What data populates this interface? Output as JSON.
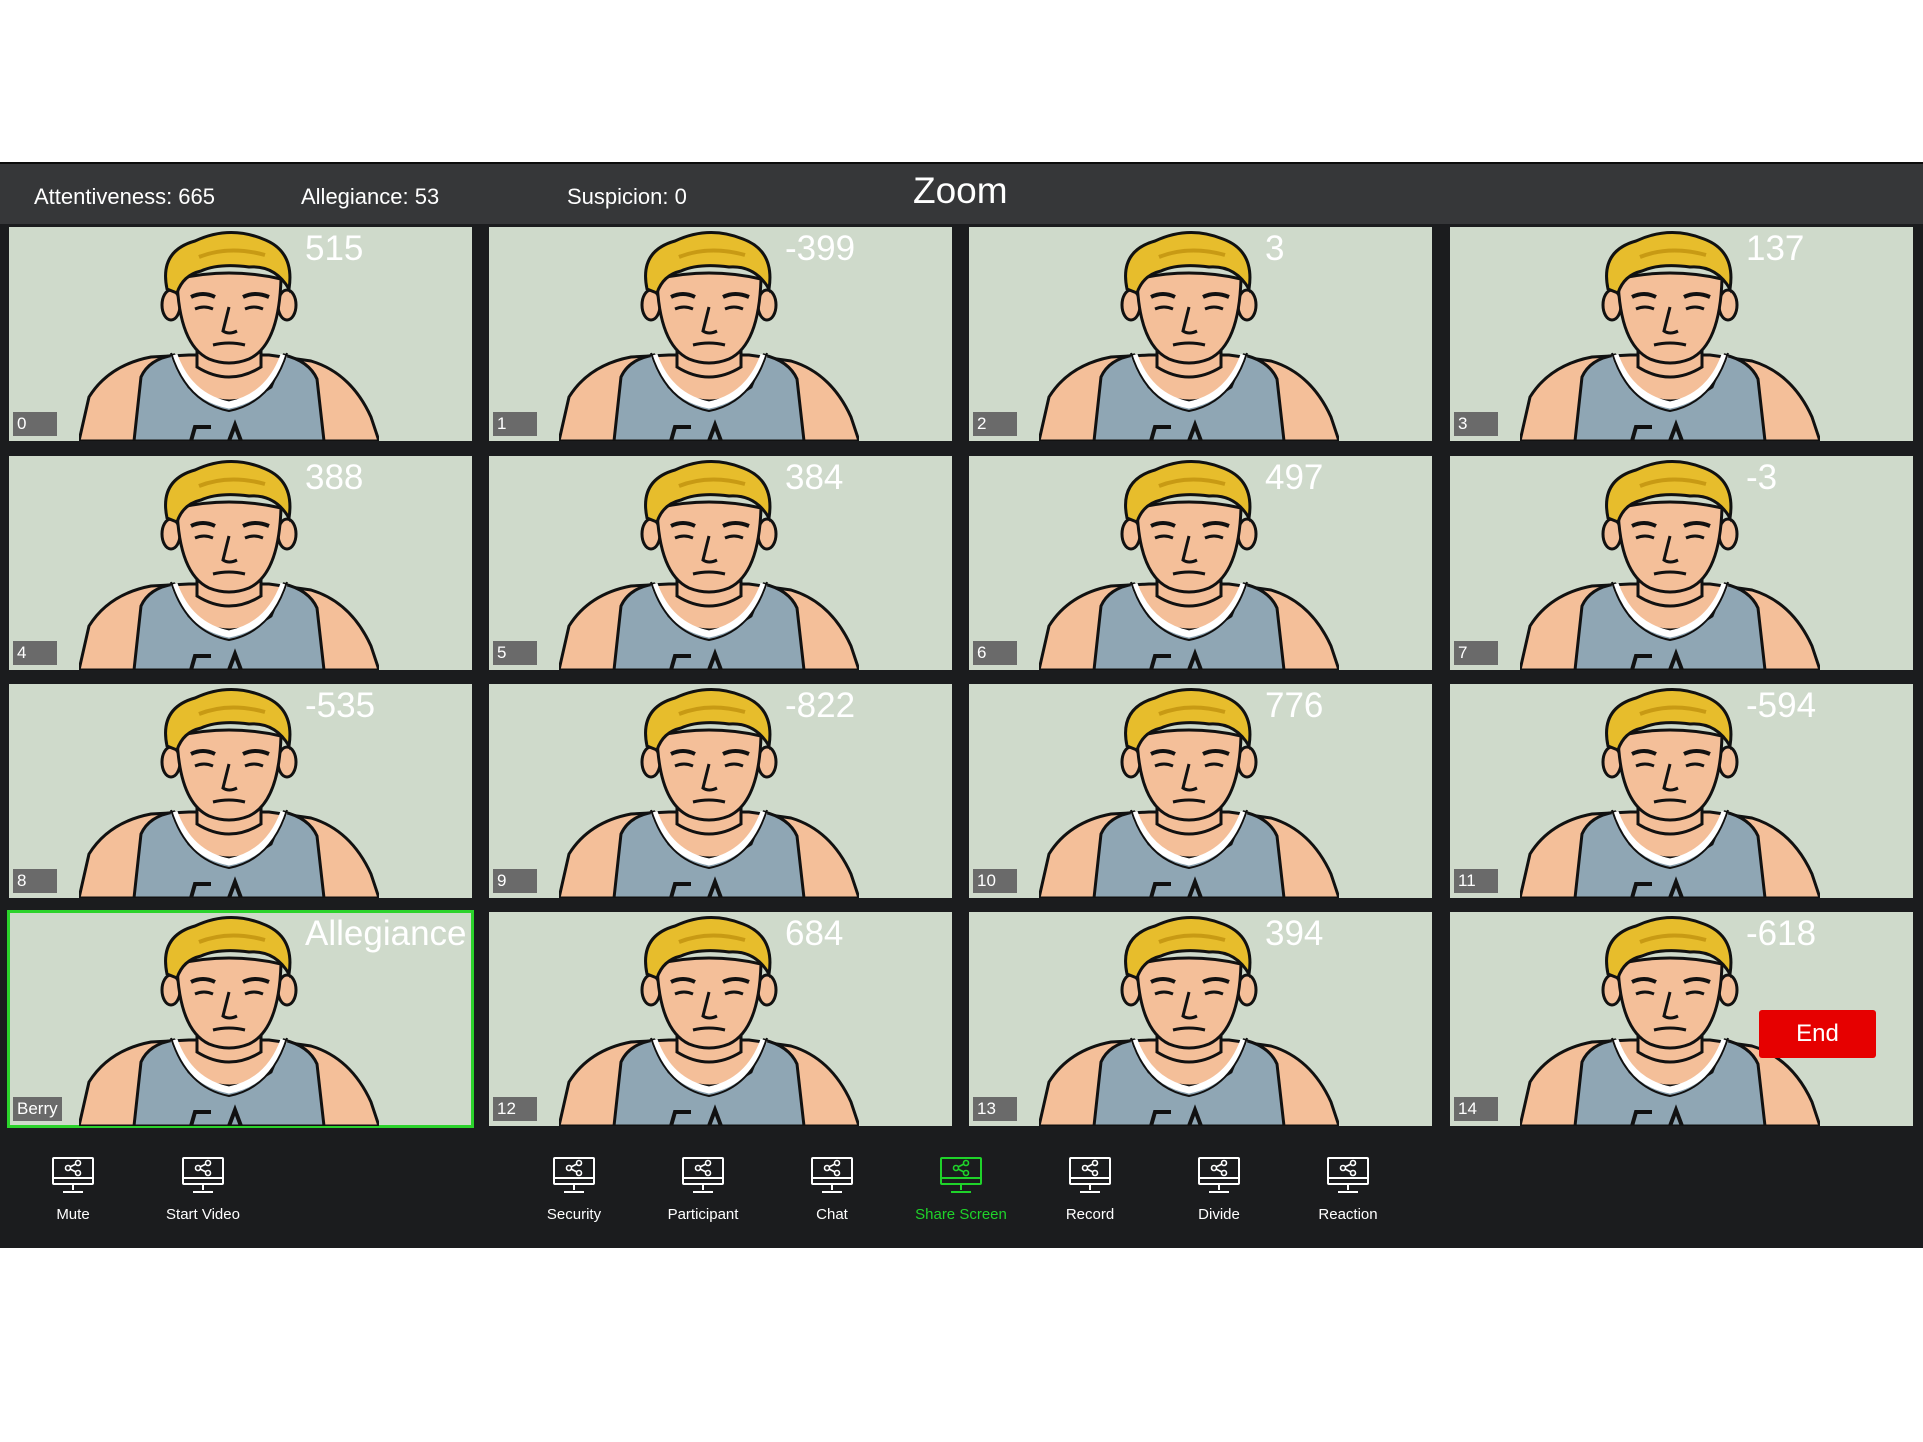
{
  "header": {
    "attentiveness_label": "Attentiveness: 665",
    "allegiance_label": "Allegiance: 53",
    "suspicion_label": "Suspicion: 0",
    "title": "Zoom"
  },
  "tiles": [
    {
      "score": "515",
      "label": "0"
    },
    {
      "score": "-399",
      "label": "1"
    },
    {
      "score": "3",
      "label": "2"
    },
    {
      "score": "137",
      "label": "3"
    },
    {
      "score": "388",
      "label": "4"
    },
    {
      "score": "384",
      "label": "5"
    },
    {
      "score": "497",
      "label": "6"
    },
    {
      "score": "-3",
      "label": "7"
    },
    {
      "score": "-535",
      "label": "8"
    },
    {
      "score": "-822",
      "label": "9"
    },
    {
      "score": "776",
      "label": "10"
    },
    {
      "score": "-594",
      "label": "11"
    },
    {
      "score": "Allegiance",
      "label": "Berry",
      "active": true
    },
    {
      "score": "684",
      "label": "12"
    },
    {
      "score": "394",
      "label": "13"
    },
    {
      "score": "-618",
      "label": "14"
    }
  ],
  "toolbar": [
    {
      "label": "Mute",
      "icon": "share-screen-icon"
    },
    {
      "label": "Start Video",
      "icon": "share-screen-icon"
    },
    {
      "label": "Security",
      "icon": "share-screen-icon"
    },
    {
      "label": "Participant",
      "icon": "share-screen-icon"
    },
    {
      "label": "Chat",
      "icon": "share-screen-icon"
    },
    {
      "label": "Share Screen",
      "icon": "share-screen-icon",
      "active": true
    },
    {
      "label": "Record",
      "icon": "share-screen-icon"
    },
    {
      "label": "Divide",
      "icon": "share-screen-icon"
    },
    {
      "label": "Reaction",
      "icon": "share-screen-icon"
    }
  ],
  "end_button": "End",
  "colors": {
    "tile_background": "#cfdacb",
    "active_outline": "#2bd32b",
    "active_toolbar": "#1fd32a",
    "end_button": "#e60000",
    "top_bar": "#363739",
    "app_background": "#1b1c1e"
  }
}
